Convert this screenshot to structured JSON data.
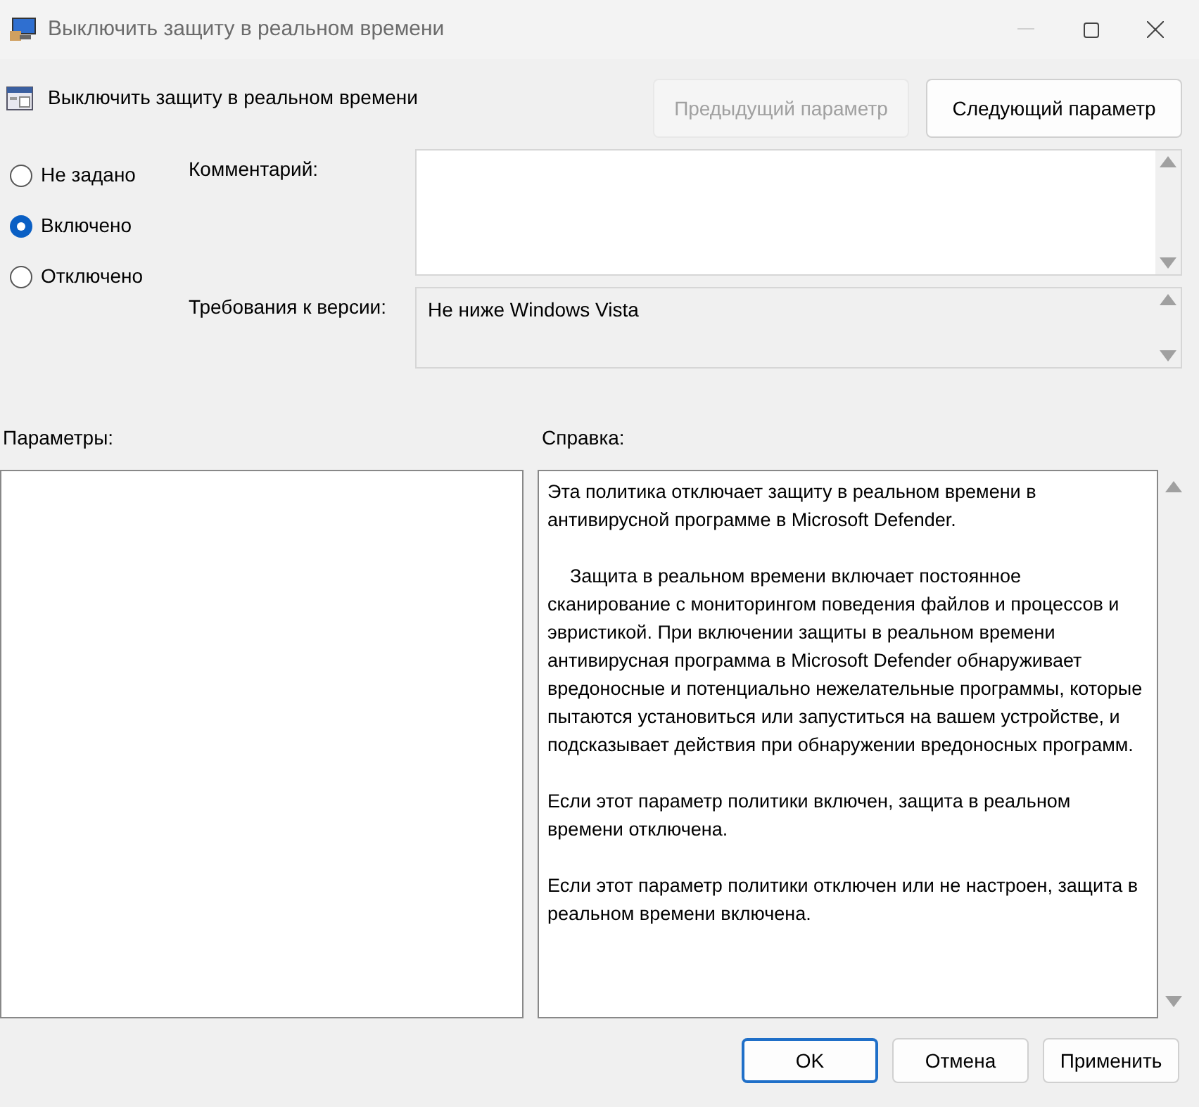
{
  "window": {
    "title": "Выключить защиту в реальном времени"
  },
  "policy_title": "Выключить защиту в реальном времени",
  "nav_buttons": [
    {
      "label": "Предыдущий параметр",
      "disabled": true
    },
    {
      "label": "Следующий параметр",
      "disabled": false
    }
  ],
  "options": [
    {
      "label": "Не задано",
      "selected": false
    },
    {
      "label": "Включено",
      "selected": true
    },
    {
      "label": "Отключено",
      "selected": false
    }
  ],
  "comment": {
    "label": "Комментарий:"
  },
  "supported_on": {
    "label": "Требования к версии:",
    "value": "Не ниже Windows Vista"
  },
  "options_panel": {
    "label": "Параметры:"
  },
  "help": {
    "label": "Справка:",
    "paragraphs": [
      {
        "text": "Эта политика отключает защиту в реальном времени в антивирусной программе в Microsoft Defender.",
        "indented": false
      },
      {
        "text": "Защита в реальном времени включает постоянное сканирование с мониторингом поведения файлов и процессов и эвристикой. При включении защиты в реальном времени антивирусная программа в Microsoft Defender обнаруживает вредоносные и потенциально нежелательные программы, которые пытаются установиться или запуститься на вашем устройстве, и подсказывает действия при обнаружении вредоносных программ.",
        "indented": true
      },
      {
        "text": "Если этот параметр политики включен, защита в реальном времени отключена.",
        "indented": false
      },
      {
        "text": "Если этот параметр политики отключен или не настроен, защита в реальном времени включена.",
        "indented": false
      }
    ]
  },
  "footer_buttons": [
    {
      "label": "OK",
      "selected": true
    },
    {
      "label": "Отмена",
      "selected": false
    },
    {
      "label": "Применить",
      "selected": false
    }
  ]
}
